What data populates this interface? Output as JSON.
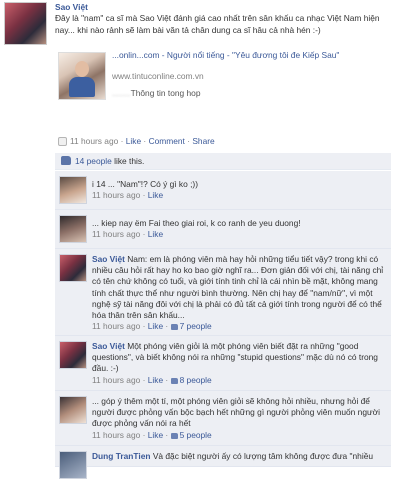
{
  "post": {
    "author": "Sao Việt",
    "text": "Đây là \"nam\" ca sĩ mà Sao Việt đánh giá cao nhất trên sân khấu ca nhạc Việt Nam hiện nay... khi nào rảnh sẽ làm bài văn tả chân dung ca sĩ hâu cả nhà hén :-)",
    "share_title": "...onlin...com - Người nổi tiếng - \"Yêu đương tôi đe Kiếp Sau\"",
    "share_url": "www.tintuconline.com.vn",
    "share_desc": "Thông tin tong hop",
    "time": "11 hours ago",
    "like_label": "Like",
    "comment_label": "Comment",
    "share_label": "Share"
  },
  "likes": {
    "count_text": "14 people",
    "suffix": " like this."
  },
  "comments": [
    {
      "author": "",
      "text": "i 14 ... \"Nam\"!? Có ý gì ko ;))",
      "time": "11 hours ago",
      "like_label": "Like",
      "likes": ""
    },
    {
      "author": "",
      "text": "... kiep nay ëm Fai theo giai roi, k co ranh de yeu duong!",
      "time": "11 hours ago",
      "like_label": "Like",
      "likes": ""
    },
    {
      "author": "Sao Việt",
      "text": "Nam: em là phóng viên mà hay hỏi những tiểu tiết vậy? trong khi có nhiều câu hỏi rất hay ho ko bao giờ nghĩ ra... Đơn giản đối với chị, tài năng chỉ có tên chứ không có tuổi, và giới tính tinh chỉ là cái nhìn bề mặt, không mang tính chất thực thể như người bình thường. Nên chị hay để \"nam/nữ\", vì một nghệ sỹ tài năng đôi với chị là phải có đủ tất cả giới tính trong người để có thể hóa thân trên sân khấu...",
      "time": "11 hours ago",
      "like_label": "Like",
      "likes": "7 people"
    },
    {
      "author": "Sao Việt",
      "text": "Một phóng viên giỏi là một phóng viên biết đặt ra những \"good questions\", và biết không nói ra những \"stupid questions\" mặc dù nó có trong đầu. :-)",
      "time": "11 hours ago",
      "like_label": "Like",
      "likes": "8 people"
    },
    {
      "author": "",
      "text": "... góp ý thêm một tí, một phóng viên giỏi sẽ không hỏi nhiều, nhưng hỏi để người được phỏng vấn bộc bạch hết những gì người phỏng viên muốn người được phỏng vấn nói ra hết",
      "time": "11 hours ago",
      "like_label": "Like",
      "likes": "5 people"
    },
    {
      "author": "Dung TranTien",
      "text": "Và đặc biệt người ấy có lượng tâm không được đưa \"nhiều",
      "time": "",
      "like_label": "",
      "likes": ""
    }
  ]
}
